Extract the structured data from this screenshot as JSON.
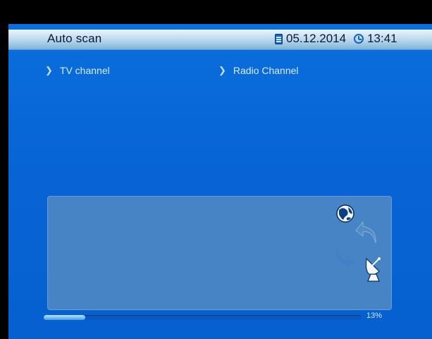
{
  "header": {
    "title": "Auto scan",
    "date": "05.12.2014",
    "time": "13:41"
  },
  "columns": {
    "tv": {
      "label": "TV channel"
    },
    "radio": {
      "label": "Radio Channel"
    }
  },
  "progress": {
    "value": 0.13,
    "label": "13%"
  },
  "icons": {
    "calendar": "calendar-icon",
    "clock": "clock-icon",
    "globe": "globe-icon",
    "arrow_up": "curved-arrow-icon",
    "arrow_down": "curved-arrow-icon",
    "satellite": "satellite-dish-icon",
    "chevron": "chevron-right-icon"
  },
  "colors": {
    "background": "#0865d6",
    "header": "#b6d6ec",
    "panel": "#4a86c6",
    "progress_fill": "#7dc2f2"
  }
}
